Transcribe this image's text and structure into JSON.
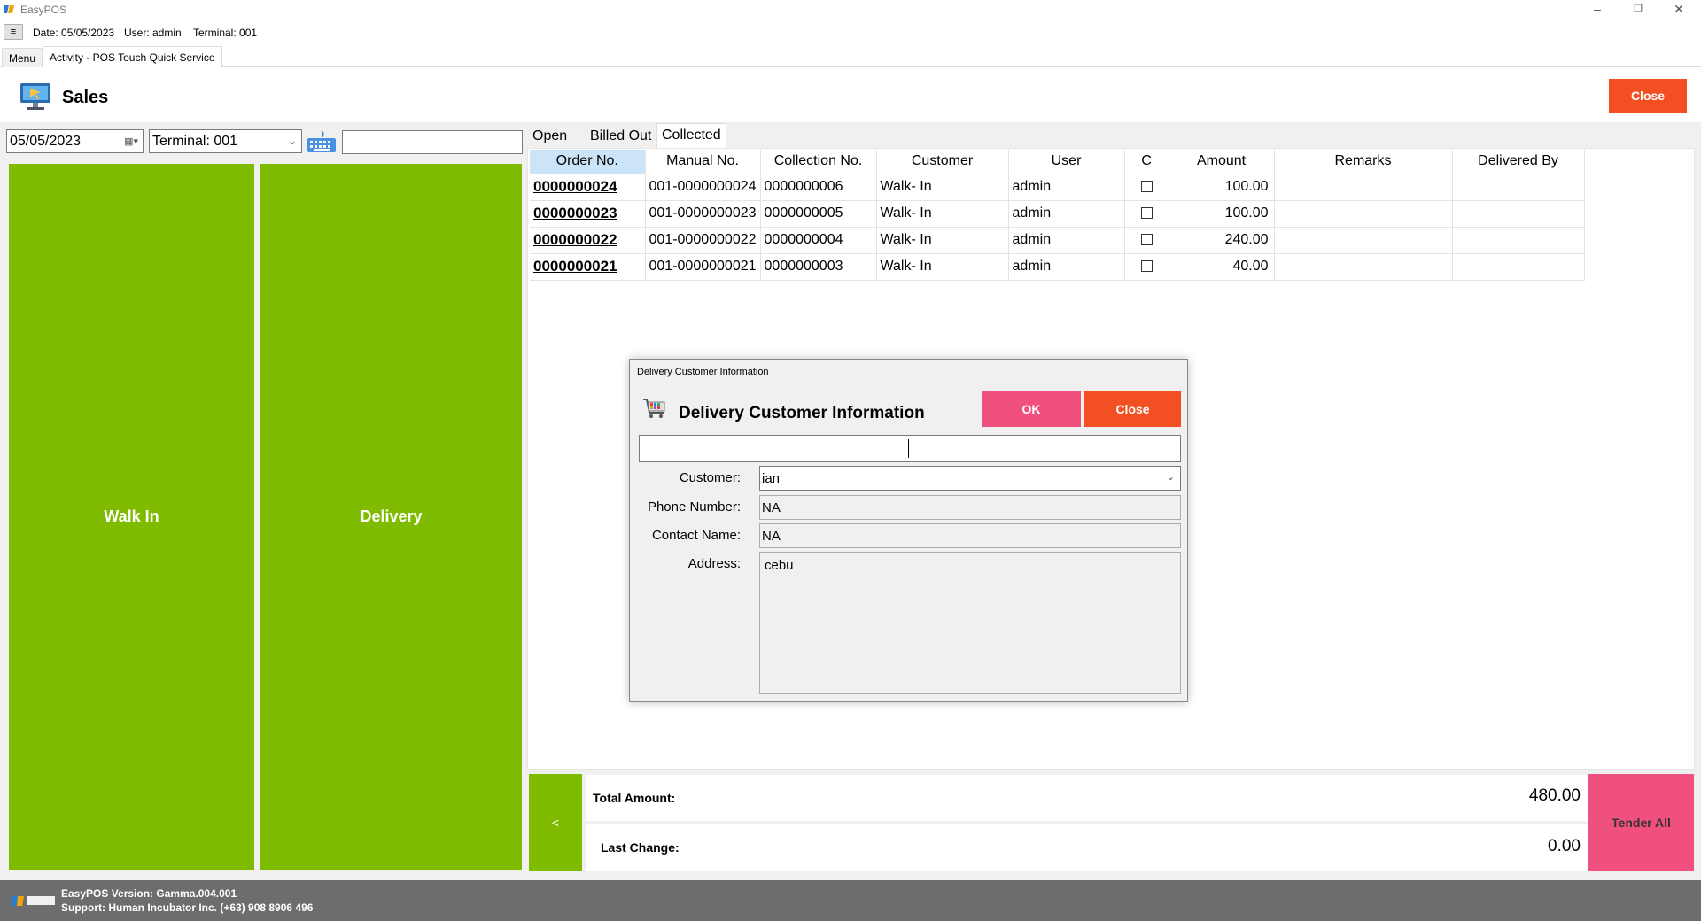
{
  "app": {
    "title": "EasyPOS"
  },
  "infobar": {
    "menu_toggle": "≡",
    "date": "Date: 05/05/2023",
    "user": "User: admin",
    "terminal": "Terminal: 001"
  },
  "tabs": [
    {
      "label": "Menu"
    },
    {
      "label": "Activity - POS Touch Quick Service"
    }
  ],
  "header": {
    "title": "Sales",
    "close_label": "Close"
  },
  "filters": {
    "date": "05/05/2023",
    "terminal": "Terminal: 001",
    "search_value": ""
  },
  "big_buttons": {
    "walk_in": "Walk In",
    "delivery": "Delivery"
  },
  "list_tabs": [
    {
      "label": "Open"
    },
    {
      "label": "Billed Out"
    },
    {
      "label": "Collected"
    }
  ],
  "grid": {
    "columns": [
      "Order No.",
      "Manual No.",
      "Collection No.",
      "Customer",
      "User",
      "C",
      "Amount",
      "Remarks",
      "Delivered By"
    ],
    "rows": [
      {
        "order_no": "0000000024",
        "manual_no": "001-0000000024",
        "collection_no": "0000000006",
        "customer": "Walk- In",
        "user": "admin",
        "amount": "100.00",
        "remarks": "",
        "delivered_by": ""
      },
      {
        "order_no": "0000000023",
        "manual_no": "001-0000000023",
        "collection_no": "0000000005",
        "customer": "Walk- In",
        "user": "admin",
        "amount": "100.00",
        "remarks": "",
        "delivered_by": ""
      },
      {
        "order_no": "0000000022",
        "manual_no": "001-0000000022",
        "collection_no": "0000000004",
        "customer": "Walk- In",
        "user": "admin",
        "amount": "240.00",
        "remarks": "",
        "delivered_by": ""
      },
      {
        "order_no": "0000000021",
        "manual_no": "001-0000000021",
        "collection_no": "0000000003",
        "customer": "Walk- In",
        "user": "admin",
        "amount": "40.00",
        "remarks": "",
        "delivered_by": ""
      }
    ]
  },
  "summary": {
    "back_label": "<",
    "total_label": "Total Amount:",
    "total_value": "480.00",
    "change_label": "Last Change:",
    "change_value": "0.00",
    "tender_label": "Tender All"
  },
  "footer": {
    "version": "EasyPOS Version: Gamma.004.001",
    "support": "Support: Human Incubator Inc. (+63) 908 8906 496"
  },
  "dialog": {
    "caption": "Delivery Customer Information",
    "title": "Delivery Customer Information",
    "ok_label": "OK",
    "close_label": "Close",
    "search_value": "",
    "customer_label": "Customer:",
    "customer_value": "ian",
    "phone_label": "Phone Number:",
    "phone_value": "NA",
    "contact_label": "Contact Name:",
    "contact_value": "NA",
    "address_label": "Address:",
    "address_value": "cebu"
  },
  "colors": {
    "green": "#7fbc00",
    "orange": "#f25022",
    "pink": "#f0507e",
    "selected_header": "#cce4f7",
    "footer": "#6d6d6d"
  }
}
